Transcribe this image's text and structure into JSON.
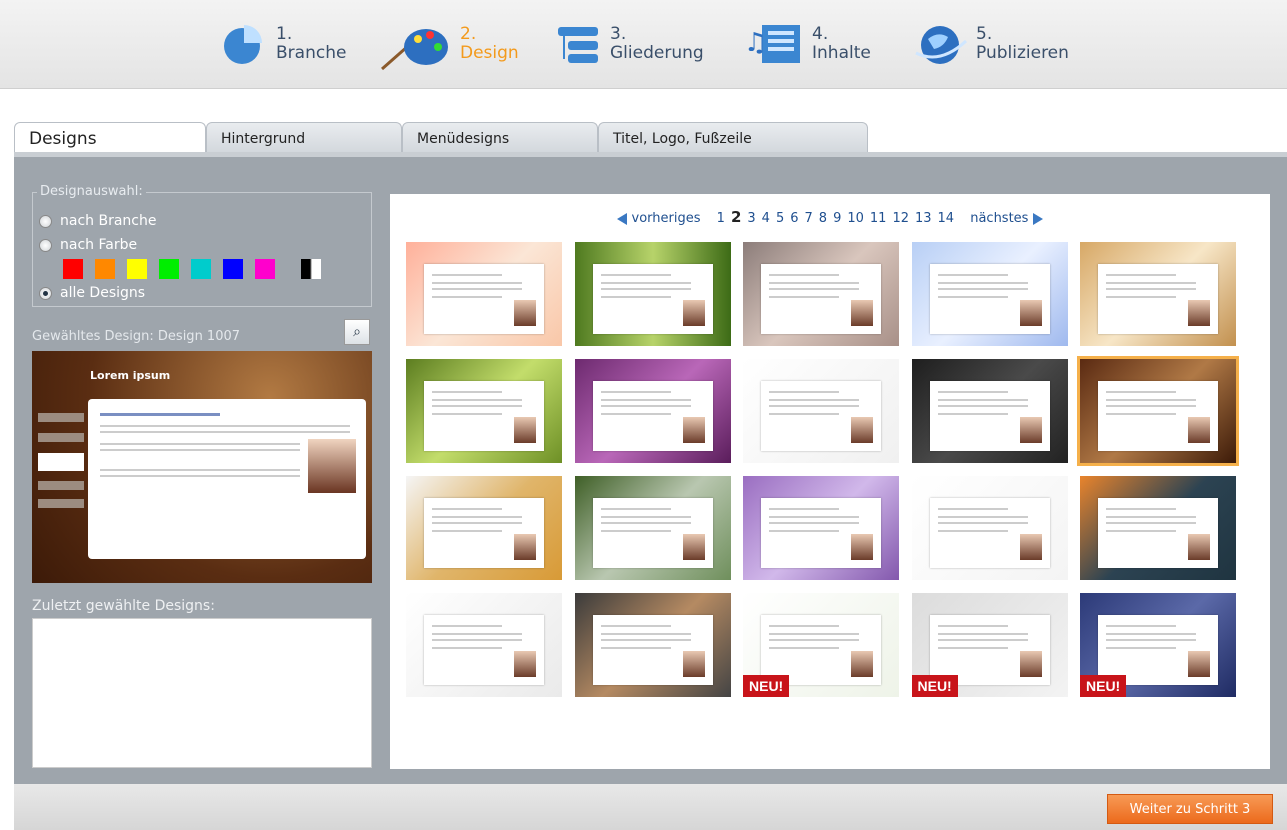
{
  "steps": [
    {
      "num": "1.",
      "label": "Branche",
      "icon": "pie-chart-icon"
    },
    {
      "num": "2.",
      "label": "Design",
      "icon": "palette-icon"
    },
    {
      "num": "3.",
      "label": "Gliederung",
      "icon": "structure-icon"
    },
    {
      "num": "4.",
      "label": "Inhalte",
      "icon": "content-icon"
    },
    {
      "num": "5.",
      "label": "Publizieren",
      "icon": "globe-icon"
    }
  ],
  "tabs": [
    "Designs",
    "Hintergrund",
    "Menüdesigns",
    "Titel, Logo, Fußzeile"
  ],
  "filter": {
    "legend": "Designauswahl:",
    "opt_branche": "nach Branche",
    "opt_farbe": "nach Farbe",
    "opt_alle": "alle Designs",
    "colors": [
      "#ff0000",
      "#ff8800",
      "#ffff00",
      "#00ee00",
      "#00cccc",
      "#0000ff",
      "#ff00cc",
      "#000000"
    ]
  },
  "selected": {
    "label": "Gewähltes Design: Design 1007",
    "preview_title": "Lorem ipsum"
  },
  "recent": {
    "label": "Zuletzt gewählte Designs:"
  },
  "pager": {
    "prev": "vorheriges",
    "next": "nächstes",
    "pages": [
      "1",
      "2",
      "3",
      "4",
      "5",
      "6",
      "7",
      "8",
      "9",
      "10",
      "11",
      "12",
      "13",
      "14"
    ],
    "current": "2"
  },
  "thumbs": [
    {
      "bg": "linear-gradient(135deg,#ffb09a,#fbe6d6 50%,#f9c7a8)"
    },
    {
      "bg": "linear-gradient(90deg,#4f7a20,#b7d36a 50%,#3d6b16)"
    },
    {
      "bg": "linear-gradient(135deg,#8c7d7a,#d9c6bd 50%,#a89088)"
    },
    {
      "bg": "linear-gradient(135deg,#b8cff5,#e9f0ff 50%,#9fb9ee)"
    },
    {
      "bg": "linear-gradient(135deg,#d7a866,#f7e6c7 50%,#c2904e)"
    },
    {
      "bg": "linear-gradient(135deg,#5c7d20,#c3dd6b 50%,#6e9026)"
    },
    {
      "bg": "linear-gradient(135deg,#6d2a6f,#b967b8 50%,#5a1d5b)"
    },
    {
      "bg": "linear-gradient(135deg,#ffffff,#f0f0f0)"
    },
    {
      "bg": "linear-gradient(135deg,#1e1e1e,#4a4a4a 50%,#222222)"
    },
    {
      "bg": "linear-gradient(135deg,#5a2a12,#b07946 50%,#3c1a08)"
    },
    {
      "bg": "linear-gradient(135deg,#f5f5f5,#e0b56a 50%,#d89a36)"
    },
    {
      "bg": "linear-gradient(135deg,#3f5f27,#b9c7b0 50%,#6f8f5c)"
    },
    {
      "bg": "linear-gradient(135deg,#9a6ec1,#d1b8ea 50%,#8358ad)"
    },
    {
      "bg": "linear-gradient(135deg,#ffffff,#f4f4f4)"
    },
    {
      "bg": "linear-gradient(135deg,#e9842c,#2c4352 50%,#1f3440)"
    },
    {
      "bg": "linear-gradient(135deg,#ffffff,#eaeaea)"
    },
    {
      "bg": "linear-gradient(135deg,#3b3b3b,#b58a62 50%,#444444)"
    },
    {
      "bg": "linear-gradient(135deg,#ffffff,#eef3e8)"
    },
    {
      "bg": "linear-gradient(135deg,#dcdcdc,#f3f3f3)"
    },
    {
      "bg": "linear-gradient(135deg,#2c3a78,#5b69a8 50%,#1f2b63)"
    }
  ],
  "neu_label": "NEU!",
  "footer": {
    "next": "Weiter zu Schritt 3"
  }
}
